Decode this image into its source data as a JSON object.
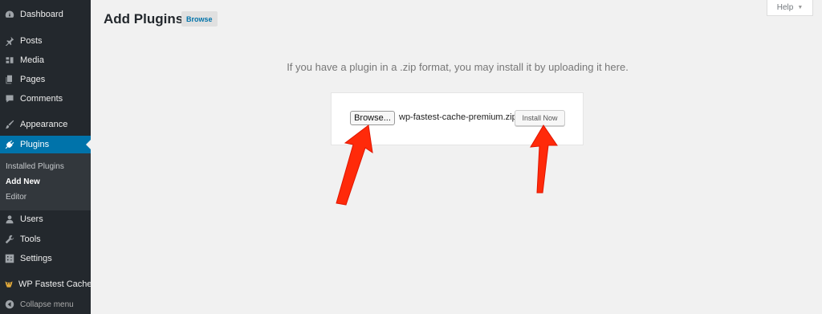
{
  "sidebar": {
    "menu": [
      {
        "label": "Dashboard",
        "icon": "dashboard-icon"
      },
      {
        "label": "Posts",
        "icon": "pin-icon"
      },
      {
        "label": "Media",
        "icon": "media-icon"
      },
      {
        "label": "Pages",
        "icon": "pages-icon"
      },
      {
        "label": "Comments",
        "icon": "comment-icon"
      },
      {
        "label": "Appearance",
        "icon": "brush-icon"
      },
      {
        "label": "Plugins",
        "icon": "plugin-icon",
        "active": true
      },
      {
        "label": "Users",
        "icon": "user-icon"
      },
      {
        "label": "Tools",
        "icon": "wrench-icon"
      },
      {
        "label": "Settings",
        "icon": "settings-icon"
      },
      {
        "label": "WP Fastest Cache",
        "icon": "cheetah-icon"
      }
    ],
    "plugins_submenu": [
      {
        "label": "Installed Plugins"
      },
      {
        "label": "Add New",
        "current": true
      },
      {
        "label": "Editor"
      }
    ],
    "collapse_label": "Collapse menu"
  },
  "header": {
    "title": "Add Plugins",
    "browse_button": "Browse",
    "help_label": "Help"
  },
  "upload": {
    "instructions": "If you have a plugin in a .zip format, you may install it by uploading it here.",
    "browse_button": "Browse...",
    "file_name": "wp-fastest-cache-premium.zip",
    "install_button": "Install Now"
  },
  "colors": {
    "sidebar_bg": "#23282d",
    "active_bg": "#0073aa",
    "annotation_arrow": "#ff2a0a"
  }
}
